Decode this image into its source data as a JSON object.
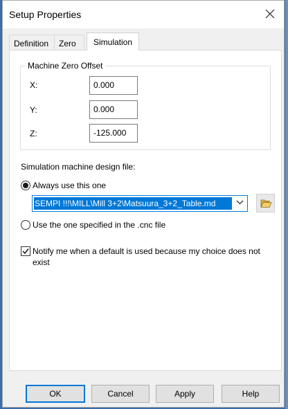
{
  "window": {
    "title": "Setup Properties"
  },
  "tabs": [
    {
      "label": "Definition",
      "selected": false
    },
    {
      "label": "Zero",
      "selected": false
    },
    {
      "label": "Simulation",
      "selected": true
    }
  ],
  "machine_zero_offset": {
    "legend": "Machine Zero Offset",
    "x": {
      "label": "X:",
      "value": "0.000"
    },
    "y": {
      "label": "Y:",
      "value": "0.000"
    },
    "z": {
      "label": "Z:",
      "value": "-125.000"
    }
  },
  "simulation": {
    "section_label": "Simulation machine design file:",
    "always_use": {
      "label": "Always use this one",
      "checked": true
    },
    "machine_file": {
      "value": "SEMPI !!!\\MILL\\Mill 3+2\\Matsuura_3+2_Table.md"
    },
    "use_cnc_file": {
      "label": "Use the one specified in the .cnc file",
      "checked": false
    },
    "notify": {
      "label": "Notify me when a default is used because my choice does not exist",
      "checked": true
    }
  },
  "buttons": {
    "ok": "OK",
    "cancel": "Cancel",
    "apply": "Apply",
    "help": "Help"
  },
  "icons": {
    "close": "close-icon",
    "browse": "folder-open-icon",
    "dropdown": "chevron-down-icon",
    "check": "checkmark-icon"
  },
  "colors": {
    "accent": "#0078d7",
    "folder": "#e8b84a"
  }
}
